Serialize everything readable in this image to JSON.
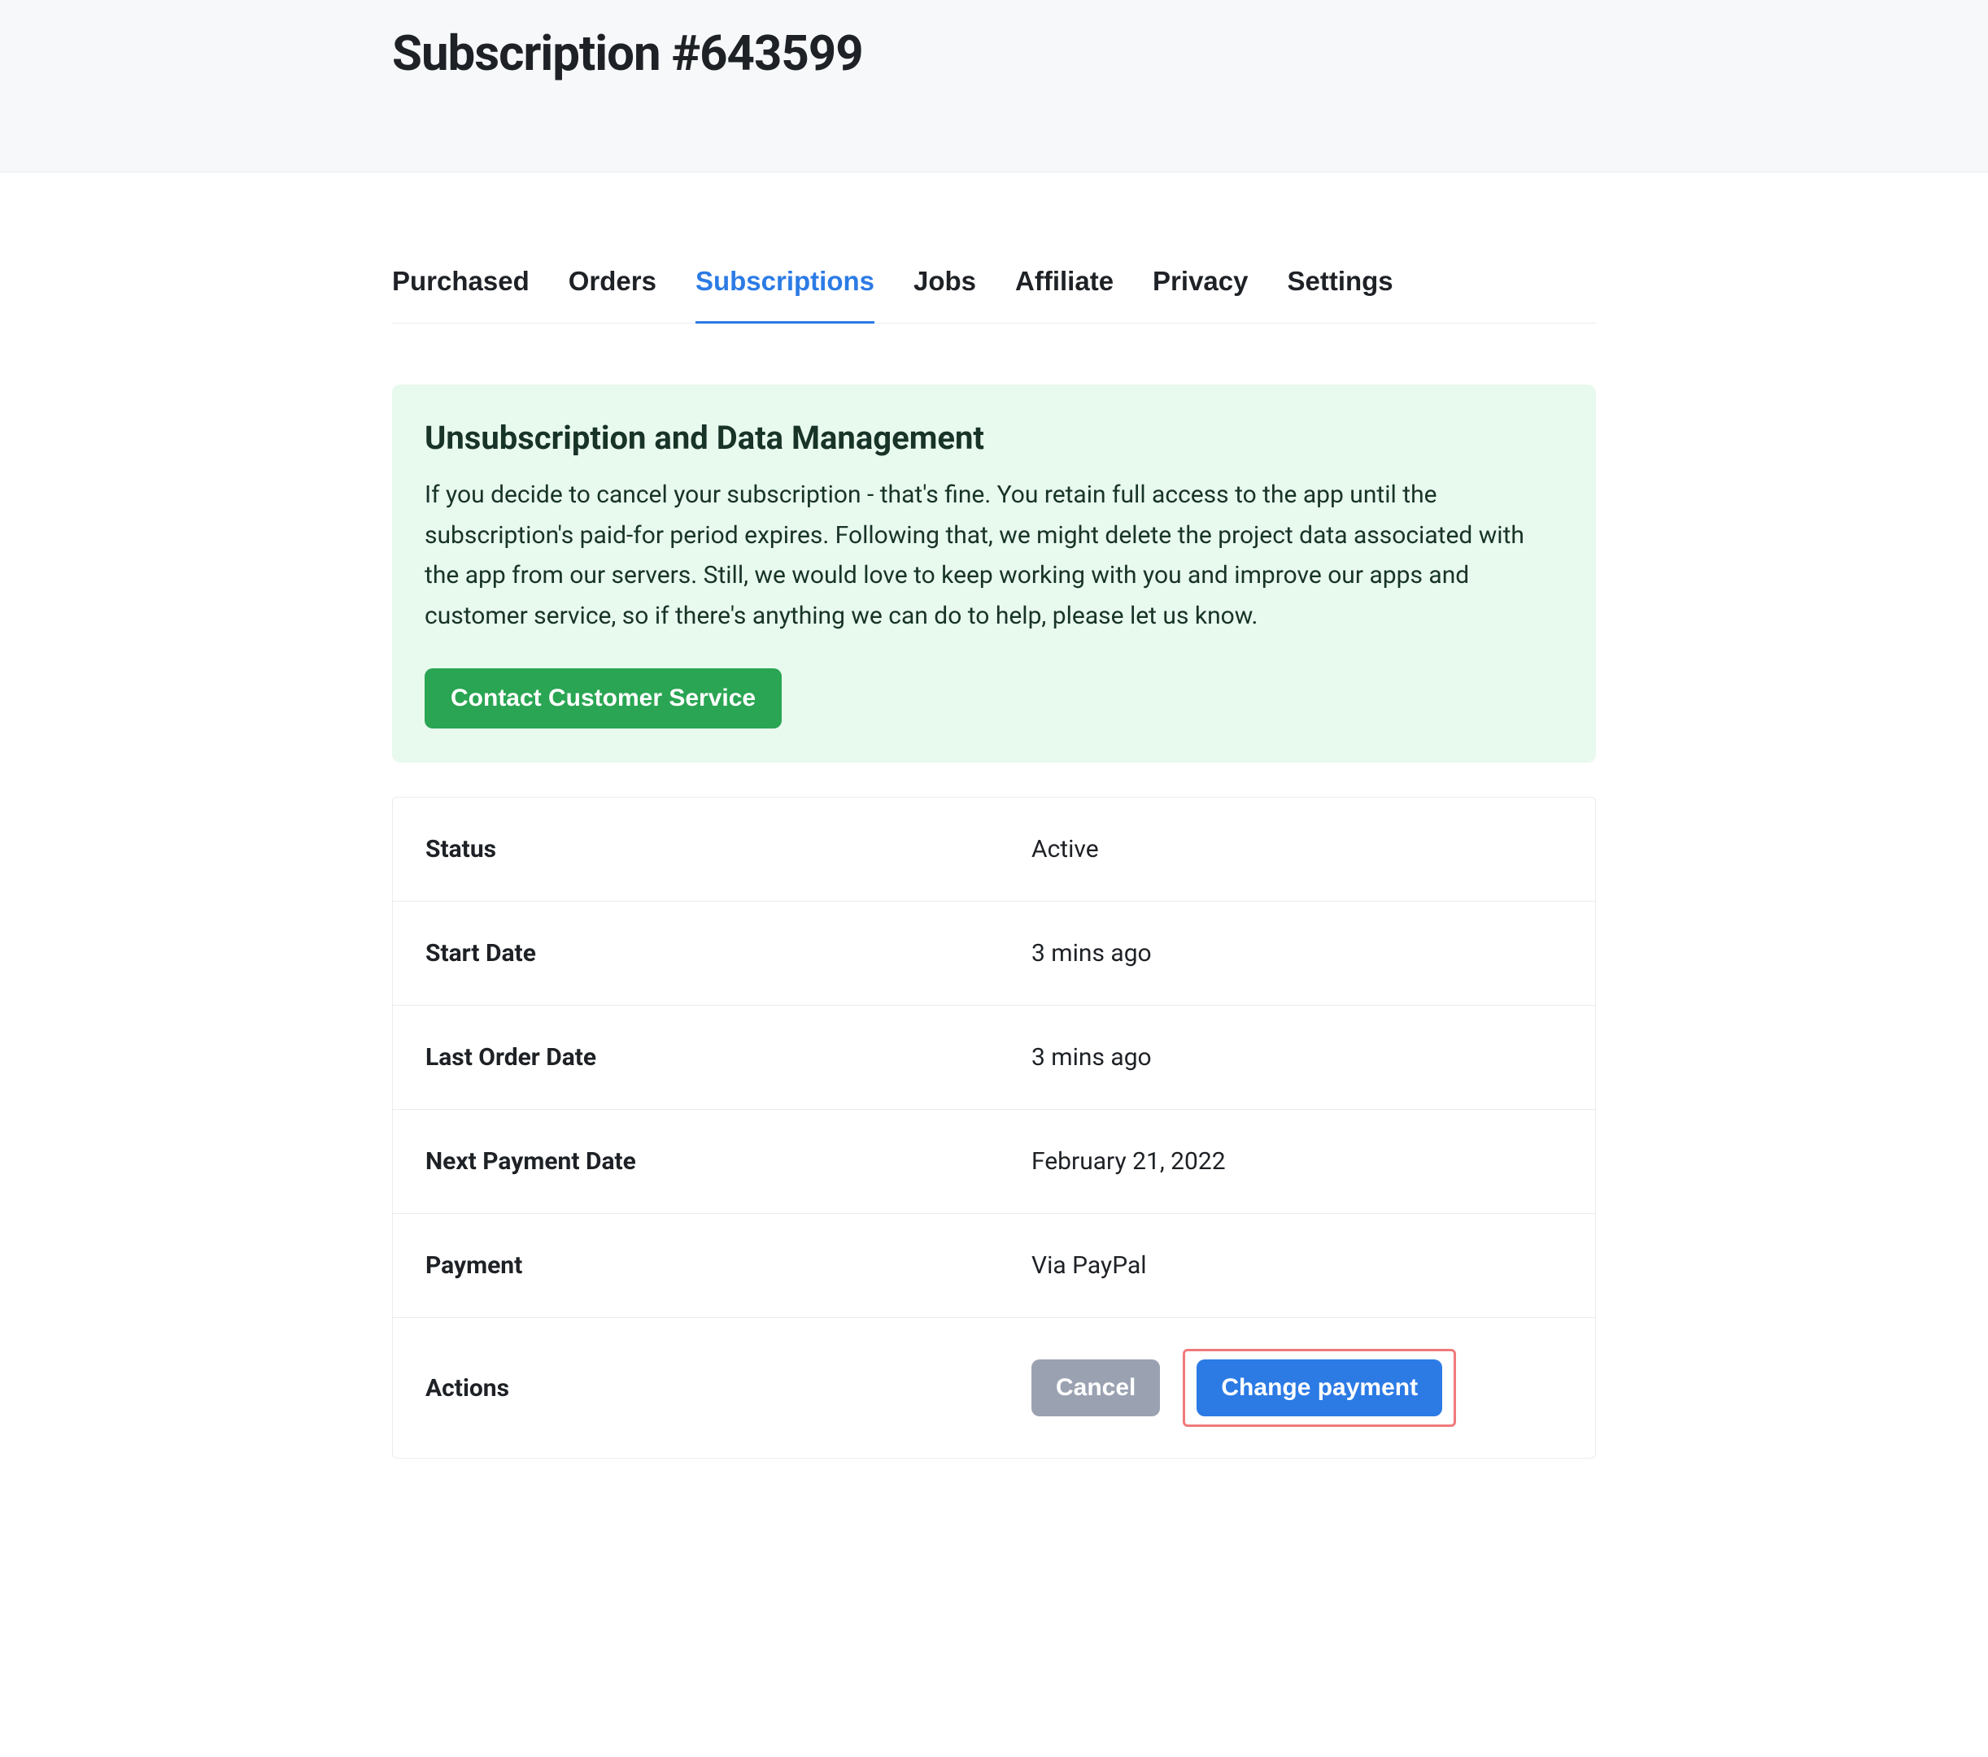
{
  "header": {
    "title": "Subscription #643599"
  },
  "tabs": {
    "purchased": "Purchased",
    "orders": "Orders",
    "subscriptions": "Subscriptions",
    "jobs": "Jobs",
    "affiliate": "Affiliate",
    "privacy": "Privacy",
    "settings": "Settings"
  },
  "notice": {
    "title": "Unsubscription and Data Management",
    "text": "If you decide to cancel your subscription - that's fine. You retain full access to the app until the subscription's paid-for period expires. Following that, we might delete the project data associated with the app from our servers. Still, we would love to keep working with you and improve our apps and customer service, so if there's anything we can do to help, please let us know.",
    "button": "Contact Customer Service"
  },
  "details": {
    "status_label": "Status",
    "status_value": "Active",
    "start_date_label": "Start Date",
    "start_date_value": "3 mins ago",
    "last_order_label": "Last Order Date",
    "last_order_value": "3 mins ago",
    "next_payment_label": "Next Payment Date",
    "next_payment_value": "February 21, 2022",
    "payment_label": "Payment",
    "payment_value": "Via PayPal",
    "actions_label": "Actions",
    "cancel_button": "Cancel",
    "change_payment_button": "Change payment"
  }
}
